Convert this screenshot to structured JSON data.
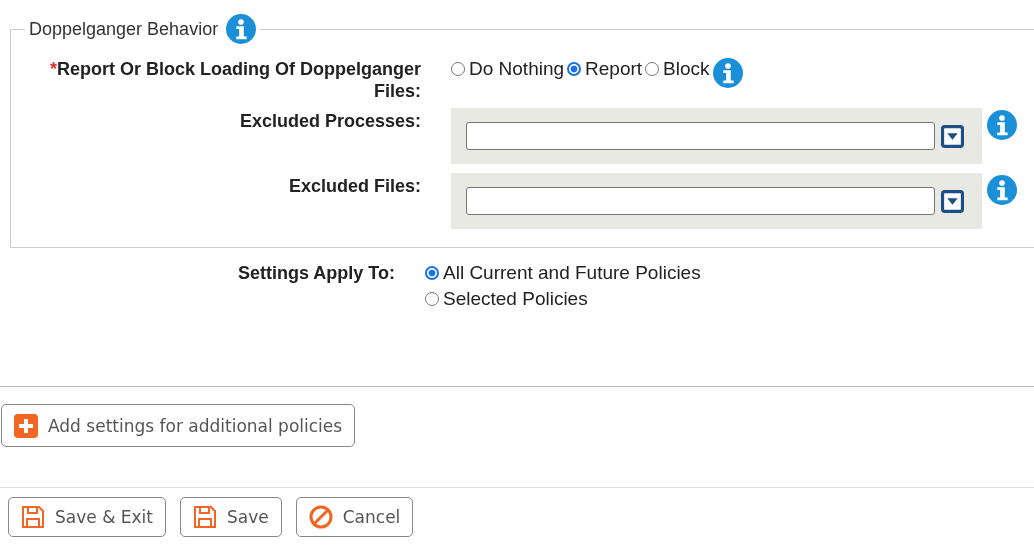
{
  "section": {
    "title": "Doppelganger Behavior",
    "action": {
      "required_mark": "*",
      "label": "Report Or Block Loading Of Doppelganger Files:",
      "options": [
        {
          "label": "Do Nothing",
          "selected": false
        },
        {
          "label": "Report",
          "selected": true
        },
        {
          "label": "Block",
          "selected": false
        }
      ]
    },
    "fields": [
      {
        "label": "Excluded Processes:"
      },
      {
        "label": "Excluded Files:"
      }
    ]
  },
  "apply_to": {
    "label": "Settings Apply To:",
    "options": [
      {
        "label": "All Current and Future Policies",
        "selected": true
      },
      {
        "label": "Selected Policies",
        "selected": false
      }
    ]
  },
  "add_button": "Add settings for additional policies",
  "buttons": [
    {
      "kind": "save",
      "label": "Save & Exit"
    },
    {
      "kind": "save",
      "label": "Save"
    },
    {
      "kind": "cancel",
      "label": "Cancel"
    }
  ]
}
